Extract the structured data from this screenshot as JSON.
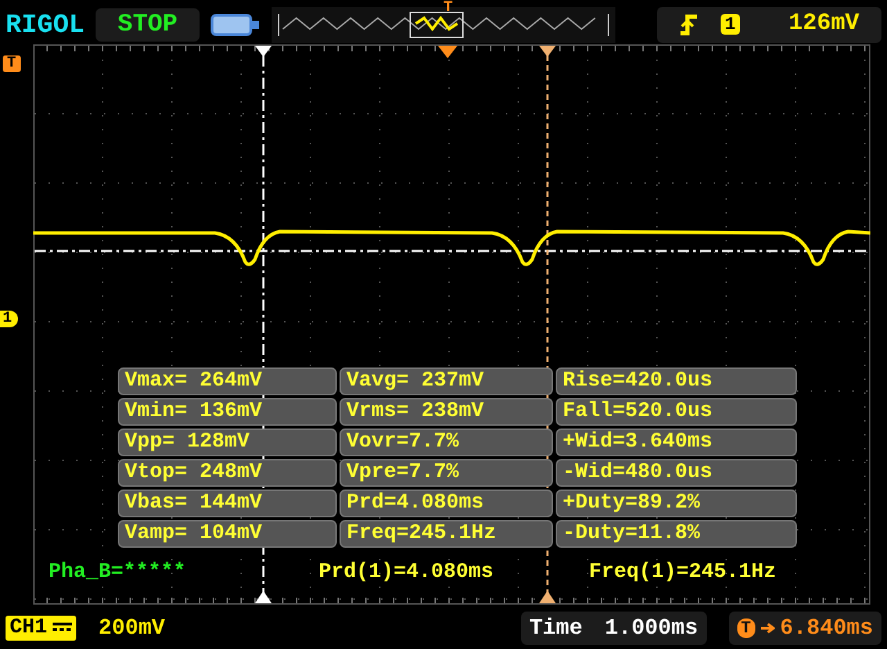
{
  "top_bar": {
    "brand": "RIGOL",
    "run_state": "STOP",
    "overview_marker": "T",
    "trigger": {
      "channel": "1",
      "level": "126mV"
    }
  },
  "screen": {
    "trigger_marker": "T",
    "channel_marker": "1",
    "measurements": [
      [
        "Vmax= 264mV",
        "Vavg= 237mV",
        "Rise=420.0us"
      ],
      [
        "Vmin= 136mV",
        "Vrms= 238mV",
        "Fall=520.0us"
      ],
      [
        "Vpp= 128mV",
        "Vovr=7.7%",
        "+Wid=3.640ms"
      ],
      [
        "Vtop= 248mV",
        "Vpre=7.7%",
        "-Wid=480.0us"
      ],
      [
        "Vbas= 144mV",
        "Prd=4.080ms",
        "+Duty=89.2%"
      ],
      [
        "Vamp= 104mV",
        "Freq=245.1Hz",
        "-Duty=11.8%"
      ]
    ],
    "status": [
      {
        "text": "Pha_B=*****",
        "color": "#22ee22"
      },
      {
        "text": "Prd(1)=4.080ms",
        "color": "#ffff33"
      },
      {
        "text": "Freq(1)=245.1Hz",
        "color": "#ffff33"
      }
    ]
  },
  "bottom_bar": {
    "channel": "CH1",
    "scale": "200mV",
    "timebase_label": "Time",
    "timebase": "1.000ms",
    "offset_marker": "T",
    "trigger_offset": "6.840ms"
  }
}
